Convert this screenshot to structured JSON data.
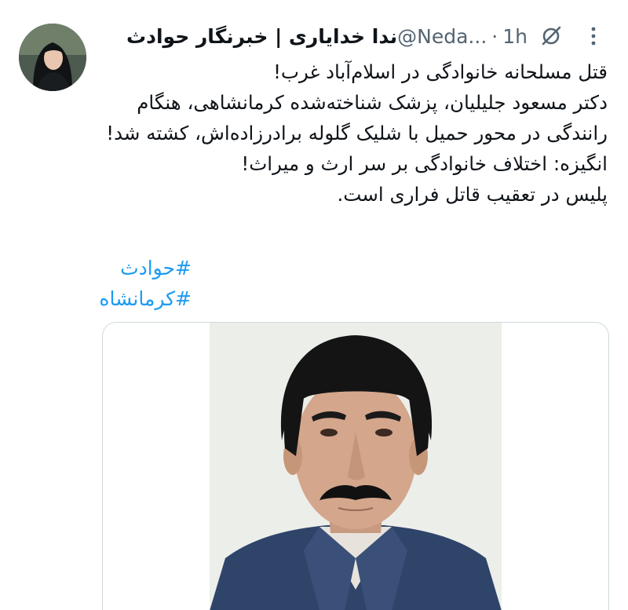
{
  "tweet": {
    "author": {
      "display_name": "ندا خدایاری | خبرنگار حوادث",
      "handle": "@Neda...",
      "time": "1h",
      "separator": "·"
    },
    "body": [
      "قتل مسلحانه خانوادگی در اسلام‌آباد غرب!",
      "دکتر مسعود جلیلیان، پزشک شناخته‌شده کرمانشاهی، هنگام رانندگی در محور حمیل با شلیک گلوله برادرزاده‌اش، کشته شد!",
      "انگیزه: اختلاف خانوادگی بر سر ارث و میراث!",
      "پلیس در تعقیب قاتل فراری است."
    ],
    "hashtags": [
      "#حوادث",
      "#کرمانشاه"
    ]
  },
  "icons": {
    "more": "more-dots-icon",
    "grok": "grok-icon"
  },
  "colors": {
    "link": "#1d9bf0",
    "text": "#0f1419",
    "secondary": "#536471",
    "border": "#cfd9de"
  }
}
